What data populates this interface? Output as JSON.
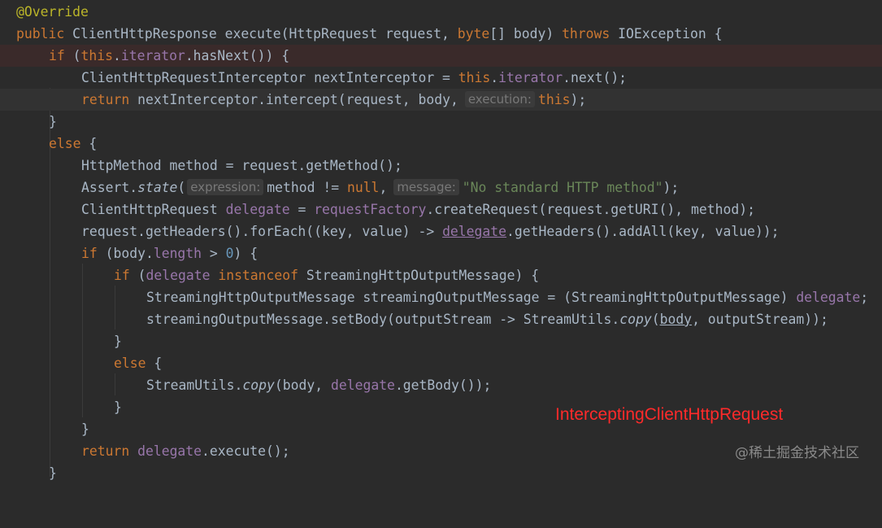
{
  "code": {
    "l1": {
      "a": "@Override"
    },
    "l2": {
      "k1": "public",
      "t1": " ClientHttpResponse execute(HttpRequest request, ",
      "k2": "byte",
      "t2": "[] body) ",
      "k3": "throws",
      "t3": " IOException {"
    },
    "l3": {
      "k1": "if",
      "t1": " (",
      "k2": "this",
      "t2": ".",
      "f1": "iterator",
      "t3": ".hasNext()) {"
    },
    "l4": {
      "t1": "ClientHttpRequestInterceptor nextInterceptor = ",
      "k1": "this",
      "t2": ".",
      "f1": "iterator",
      "t3": ".next();"
    },
    "l5": {
      "k1": "return",
      "t1": " nextInterceptor.intercept(request, body,",
      "h1": "execution:",
      "k2": "this",
      "t2": ");"
    },
    "l6": {
      "t1": "}"
    },
    "l7": {
      "k1": "else",
      "t1": " {"
    },
    "l8": {
      "t1": "HttpMethod method = request.getMethod();"
    },
    "l9": {
      "t1": "Assert.",
      "i1": "state",
      "t2": "(",
      "h1": "expression:",
      "t3": "method != ",
      "k1": "null",
      "t4": ",",
      "h2": "message:",
      "s1": "\"No standard HTTP method\"",
      "t5": ");"
    },
    "l10": {
      "t1": "ClientHttpRequest ",
      "v1": "delegate",
      "t2": " = ",
      "f1": "requestFactory",
      "t3": ".createRequest(request.getURI(), method);"
    },
    "l11": {
      "t1": "request.getHeaders().forEach((key, value) -> ",
      "v1": "delegate",
      "t2": ".getHeaders().addAll(key, value));"
    },
    "l12": {
      "k1": "if",
      "t1": " (body.",
      "f1": "length",
      "t2": " > ",
      "n1": "0",
      "t3": ") {"
    },
    "l13": {
      "k1": "if",
      "t1": " (",
      "v1": "delegate",
      "t2": " ",
      "k2": "instanceof",
      "t3": " StreamingHttpOutputMessage) {"
    },
    "l14": {
      "t1": "StreamingHttpOutputMessage streamingOutputMessage = (StreamingHttpOutputMessage) ",
      "v1": "delegate",
      "t2": ";"
    },
    "l15": {
      "t1": "streamingOutputMessage.setBody(outputStream -> StreamUtils.",
      "i1": "copy",
      "t2": "(",
      "v1": "body",
      "t3": ", outputStream));"
    },
    "l16": {
      "t1": "}"
    },
    "l17": {
      "k1": "else",
      "t1": " {"
    },
    "l18": {
      "t1": "StreamUtils.",
      "i1": "copy",
      "t2": "(body, ",
      "v1": "delegate",
      "t3": ".getBody());"
    },
    "l19": {
      "t1": "}"
    },
    "l20": {
      "t1": "}"
    },
    "l21": {
      "k1": "return",
      "t1": " ",
      "v1": "delegate",
      "t2": ".execute();"
    },
    "l22": {
      "t1": "}"
    }
  },
  "colors": {
    "background": "#2b2b2b",
    "keyword": "#cc7832",
    "annotation": "#bbb529",
    "field": "#9876aa",
    "string": "#6a8759",
    "number": "#6897bb",
    "label": "#ff2a2a"
  },
  "overlay_label": "InterceptingClientHttpRequest",
  "watermark": "@稀土掘金技术社区"
}
